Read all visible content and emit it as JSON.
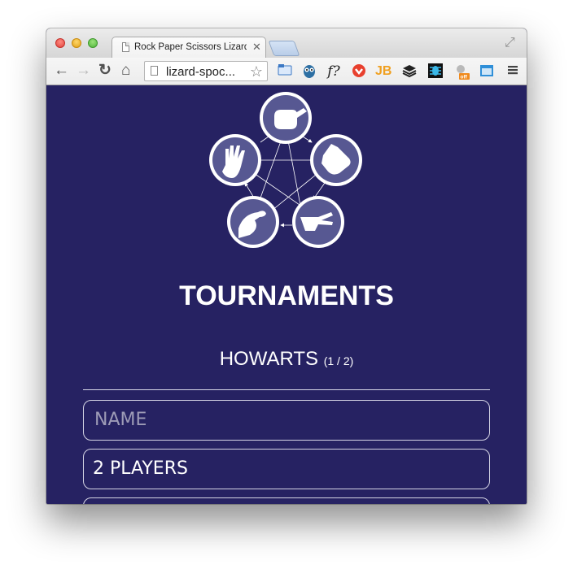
{
  "browser": {
    "tab_title": "Rock Paper Scissors Lizard Spock",
    "tab_close": "✕",
    "url": "lizard-spoc...",
    "nav": {
      "back": "←",
      "forward": "→",
      "reload": "↻",
      "home": "⌂"
    },
    "star": "☆",
    "fullscreen": "⤢",
    "extensions": [
      "folder-icon",
      "owl-icon",
      "font-question-icon",
      "adblock-icon",
      "jb-icon",
      "layers-icon",
      "bug-icon",
      "robot-off-icon",
      "window-icon",
      "menu-icon"
    ]
  },
  "page": {
    "title": "TOURNAMENTS",
    "tournament_name": "HOWARTS",
    "tournament_count": "(1 / 2)",
    "name_placeholder": "NAME",
    "players_value": "2 PLAYERS"
  },
  "colors": {
    "background": "#262262",
    "logo_fill": "#575892",
    "text": "#ffffff"
  }
}
